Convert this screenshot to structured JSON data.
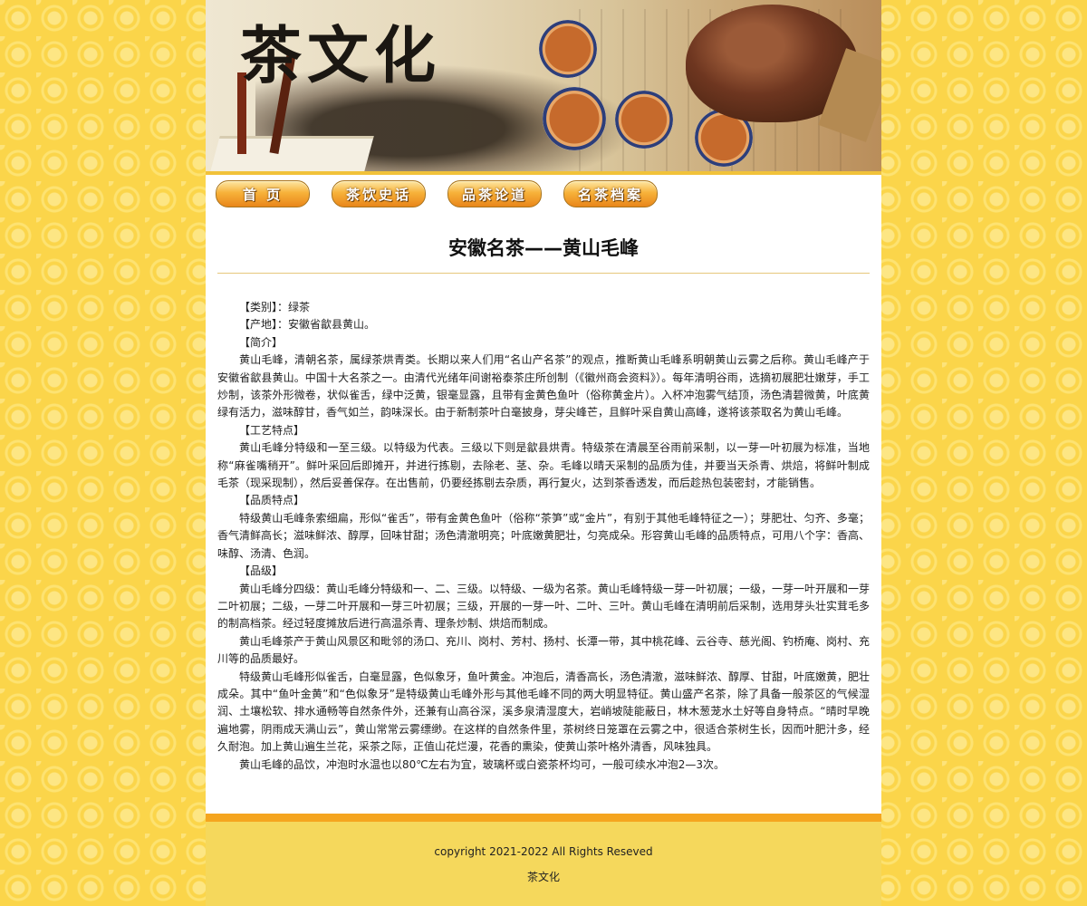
{
  "banner": {
    "title": "茶文化"
  },
  "nav": [
    {
      "label": "首 页"
    },
    {
      "label": "茶饮史话"
    },
    {
      "label": "品茶论道"
    },
    {
      "label": "名茶档案"
    }
  ],
  "article": {
    "title": "安徽名茶——黄山毛峰",
    "paragraphs": [
      "【类别】：绿茶",
      "【产地】：安徽省歙县黄山。",
      "【简介】",
      "黄山毛峰，清朝名茶，属绿茶烘青类。长期以来人们用“名山产名茶”的观点，推断黄山毛峰系明朝黄山云雾之后称。黄山毛峰产于安徽省歙县黄山。中国十大名茶之一。由清代光绪年间谢裕泰茶庄所创制（《徽州商会资料》）。每年清明谷雨，选摘初展肥壮嫩芽，手工炒制，该茶外形微卷，状似雀舌，绿中泛黄，银毫显露，且带有金黄色鱼叶（俗称黄金片）。入杯冲泡雾气结顶，汤色清碧微黄，叶底黄绿有活力，滋味醇甘，香气如兰，韵味深长。由于新制茶叶白毫披身，芽尖峰芒，且鲜叶采自黄山高峰，遂将该茶取名为黄山毛峰。",
      "【工艺特点】",
      "黄山毛峰分特级和一至三级。以特级为代表。三级以下则是歙县烘青。特级茶在清晨至谷雨前采制，以一芽一叶初展为标准，当地称“麻雀嘴稍开”。鲜叶采回后即摊开，并进行拣剔，去除老、茎、杂。毛峰以晴天采制的品质为佳，并要当天杀青、烘焙，将鲜叶制成毛茶（现采现制），然后妥善保存。在出售前，仍要经拣剔去杂质，再行复火，达到茶香透发，而后趁热包装密封，才能销售。",
      "【品质特点】",
      "特级黄山毛峰条索细扁，形似“雀舌”，带有金黄色鱼叶（俗称“茶笋”或“金片”，有别于其他毛峰特征之一）；芽肥壮、匀齐、多毫；香气清鲜高长；滋味鲜浓、醇厚，回味甘甜；汤色清澈明亮；叶底嫩黄肥壮，匀亮成朵。形容黄山毛峰的品质特点，可用八个字：香高、味醇、汤清、色润。",
      "【品级】",
      "黄山毛峰分四级：黄山毛峰分特级和一、二、三级。以特级、一级为名茶。黄山毛峰特级一芽一叶初展；一级，一芽一叶开展和一芽二叶初展；二级，一芽二叶开展和一芽三叶初展；三级，开展的一芽一叶、二叶、三叶。黄山毛峰在清明前后采制，选用芽头壮实茸毛多的制高档茶。经过轻度摊放后进行高温杀青、理条炒制、烘焙而制成。",
      "黄山毛峰茶产于黄山风景区和毗邻的汤口、充川、岗村、芳村、扬村、长潭一带，其中桃花峰、云谷寺、慈光阁、钓桥庵、岗村、充川等的品质最好。",
      "特级黄山毛峰形似雀舌，白毫显露，色似象牙，鱼叶黄金。冲泡后，清香高长，汤色清澈，滋味鲜浓、醇厚、甘甜，叶底嫩黄，肥壮成朵。其中“鱼叶金黄”和“色似象牙”是特级黄山毛峰外形与其他毛峰不同的两大明显特征。黄山盛产名茶，除了具备一般茶区的气候湿润、土壤松软、排水通畅等自然条件外，还兼有山高谷深，溪多泉清湿度大，岩峭坡陡能蔽日，林木葱茏水土好等自身特点。“晴时早晚遍地雾，阴雨成天满山云”，黄山常常云雾缥缈。在这样的自然条件里，茶树终日笼罩在云雾之中，很适合茶树生长，因而叶肥汁多，经久耐泡。加上黄山遍生兰花，采茶之际，正值山花烂漫，花香的熏染，使黄山茶叶格外清香，风味独具。",
      "黄山毛峰的品饮，冲泡时水温也以80℃左右为宜，玻璃杯或白瓷茶杯均可，一般可续水冲泡2—3次。"
    ]
  },
  "footer": {
    "copyright": "copyright 2021-2022 All Rights Reseved",
    "site": "茶文化"
  }
}
